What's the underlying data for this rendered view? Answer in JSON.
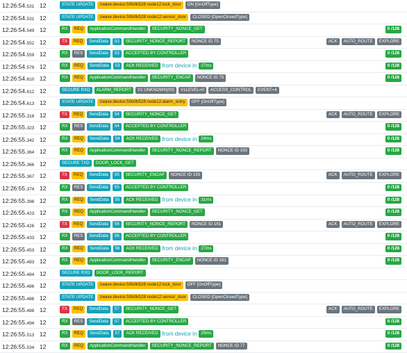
{
  "colors": {
    "green": "#28a745",
    "blue": "#17a2b8",
    "red": "#dc3545",
    "yellow": "#ffc107",
    "gray": "#6c757d",
    "link_text": "#17a2b8"
  },
  "rows": [
    {
      "time": "12:26:54.",
      "ms": "531",
      "node": "12",
      "badges": [
        {
          "t": "STATE UPDATE",
          "c": "blue"
        },
        {
          "t": "zwave:device:50b0b528:node12:lock_door",
          "c": "yellow"
        },
        {
          "t": "ON [OnOffType]",
          "c": "gray"
        }
      ],
      "right": [],
      "right_badge": null
    },
    {
      "time": "12:26:54.",
      "ms": "531",
      "node": "12",
      "badges": [
        {
          "t": "STATE UPDATE",
          "c": "blue"
        },
        {
          "t": "zwave:device:50b0b528:node12:sensor_door",
          "c": "yellow"
        },
        {
          "t": "CLOSED [OpenClosedType]",
          "c": "gray"
        }
      ],
      "right": [],
      "right_badge": null
    },
    {
      "time": "12:26:54.",
      "ms": "549",
      "node": "12",
      "badges": [
        {
          "t": "RX",
          "c": "green"
        },
        {
          "t": "REQ",
          "c": "yellow"
        },
        {
          "t": "ApplicationCommandHandler",
          "c": "green"
        },
        {
          "t": "SECURITY_NONCE_GET",
          "c": "green"
        }
      ],
      "right": [],
      "right_badge": "0 /128"
    },
    {
      "time": "12:26:54.",
      "ms": "552",
      "node": "12",
      "badges": [
        {
          "t": "TX",
          "c": "red"
        },
        {
          "t": "REQ",
          "c": "yellow"
        },
        {
          "t": "SendData",
          "c": "blue"
        },
        {
          "t": "53",
          "c": "blue"
        },
        {
          "t": "SECURITY_NONCE_REPORT",
          "c": "green"
        },
        {
          "t": "NONCE ID 75",
          "c": "gray"
        }
      ],
      "right": [
        "ACK",
        "AUTO_ROUTE",
        "EXPLORE"
      ],
      "right_badge": null
    },
    {
      "time": "12:26:54.",
      "ms": "559",
      "node": "12",
      "badges": [
        {
          "t": "RX",
          "c": "green"
        },
        {
          "t": "RES",
          "c": "gray"
        },
        {
          "t": "SendData",
          "c": "blue"
        },
        {
          "t": "53",
          "c": "blue"
        },
        {
          "t": "ACCEPTED BY CONTROLLER",
          "c": "green"
        }
      ],
      "right": [],
      "right_badge": "0 /128"
    },
    {
      "time": "12:26:54.",
      "ms": "579",
      "node": "12",
      "badges": [
        {
          "t": "RX",
          "c": "green"
        },
        {
          "t": "REQ",
          "c": "yellow"
        },
        {
          "t": "SendData",
          "c": "blue"
        },
        {
          "t": "53",
          "c": "blue"
        },
        {
          "t": "ACK RECEIVED",
          "c": "green"
        },
        {
          "t": "from device in",
          "c": "plain"
        },
        {
          "t": "27ms",
          "c": "green"
        }
      ],
      "right": [],
      "right_badge": "0 /128"
    },
    {
      "time": "12:26:54.",
      "ms": "610",
      "node": "12",
      "badges": [
        {
          "t": "RX",
          "c": "green"
        },
        {
          "t": "REQ",
          "c": "yellow"
        },
        {
          "t": "ApplicationCommandHandler",
          "c": "green"
        },
        {
          "t": "SECURITY_ENCAP",
          "c": "green"
        },
        {
          "t": "NONCE ID 75",
          "c": "gray"
        }
      ],
      "right": [],
      "right_badge": "0 /128"
    },
    {
      "time": "12:26:54.",
      "ms": "612",
      "node": "12",
      "badges": [
        {
          "t": "SECURE RXD",
          "c": "blue"
        },
        {
          "t": "ALARM_REPORT",
          "c": "green"
        },
        {
          "t": "V1 UNKNOWN(00)",
          "c": "gray"
        },
        {
          "t": "V1LEVEL=0",
          "c": "gray"
        },
        {
          "t": "ACCESS_CONTROL",
          "c": "gray"
        },
        {
          "t": "EVENT=4",
          "c": "gray"
        }
      ],
      "right": [],
      "right_badge": null
    },
    {
      "time": "12:26:54.",
      "ms": "613",
      "node": "12",
      "badges": [
        {
          "t": "STATE UPDATE",
          "c": "blue"
        },
        {
          "t": "zwave:device:50b0b528:node12:alarm_entry",
          "c": "yellow"
        },
        {
          "t": "OFF [OnOffType]",
          "c": "gray"
        }
      ],
      "right": [],
      "right_badge": null
    },
    {
      "time": "12:26:55.",
      "ms": "318",
      "node": "12",
      "badges": [
        {
          "t": "TX",
          "c": "red"
        },
        {
          "t": "REQ",
          "c": "yellow"
        },
        {
          "t": "SendData",
          "c": "blue"
        },
        {
          "t": "54",
          "c": "blue"
        },
        {
          "t": "SECURITY_NONCE_GET",
          "c": "green"
        }
      ],
      "right": [
        "ACK",
        "AUTO_ROUTE",
        "EXPLORE"
      ],
      "right_badge": null
    },
    {
      "time": "12:26:55.",
      "ms": "323",
      "node": "12",
      "badges": [
        {
          "t": "RX",
          "c": "green"
        },
        {
          "t": "RES",
          "c": "gray"
        },
        {
          "t": "SendData",
          "c": "blue"
        },
        {
          "t": "54",
          "c": "blue"
        },
        {
          "t": "ACCEPTED BY CONTROLLER",
          "c": "green"
        }
      ],
      "right": [],
      "right_badge": "0 /128"
    },
    {
      "time": "12:26:55.",
      "ms": "342",
      "node": "12",
      "badges": [
        {
          "t": "RX",
          "c": "green"
        },
        {
          "t": "REQ",
          "c": "yellow"
        },
        {
          "t": "SendData",
          "c": "blue"
        },
        {
          "t": "54",
          "c": "blue"
        },
        {
          "t": "ACK RECEIVED",
          "c": "green"
        },
        {
          "t": "from device in",
          "c": "plain"
        },
        {
          "t": "24ms",
          "c": "green"
        }
      ],
      "right": [],
      "right_badge": "0 /128"
    },
    {
      "time": "12:26:55.",
      "ms": "364",
      "node": "12",
      "badges": [
        {
          "t": "RX",
          "c": "green"
        },
        {
          "t": "REQ",
          "c": "yellow"
        },
        {
          "t": "ApplicationCommandHandler",
          "c": "green"
        },
        {
          "t": "SECURITY_NONCE_REPORT",
          "c": "green"
        },
        {
          "t": "NONCE ID 193",
          "c": "gray"
        }
      ],
      "right": [],
      "right_badge": "0 /128"
    },
    {
      "time": "12:26:55.",
      "ms": "366",
      "node": "12",
      "badges": [
        {
          "t": "SECURE TXD",
          "c": "blue"
        },
        {
          "t": "DOOR_LOCK_GET",
          "c": "green"
        }
      ],
      "right": [],
      "right_badge": null
    },
    {
      "time": "12:26:55.",
      "ms": "367",
      "node": "12",
      "badges": [
        {
          "t": "TX",
          "c": "red"
        },
        {
          "t": "REQ",
          "c": "yellow"
        },
        {
          "t": "SendData",
          "c": "blue"
        },
        {
          "t": "55",
          "c": "blue"
        },
        {
          "t": "SECURITY_ENCAP",
          "c": "green"
        },
        {
          "t": "NONCE ID 193",
          "c": "gray"
        }
      ],
      "right": [
        "ACK",
        "AUTO_ROUTE",
        "EXPLORE"
      ],
      "right_badge": null
    },
    {
      "time": "12:26:55.",
      "ms": "374",
      "node": "12",
      "badges": [
        {
          "t": "RX",
          "c": "green"
        },
        {
          "t": "RES",
          "c": "gray"
        },
        {
          "t": "SendData",
          "c": "blue"
        },
        {
          "t": "55",
          "c": "blue"
        },
        {
          "t": "ACCEPTED BY CONTROLLER",
          "c": "green"
        }
      ],
      "right": [],
      "right_badge": "0 /128"
    },
    {
      "time": "12:26:55.",
      "ms": "398",
      "node": "12",
      "badges": [
        {
          "t": "RX",
          "c": "green"
        },
        {
          "t": "REQ",
          "c": "yellow"
        },
        {
          "t": "SendData",
          "c": "blue"
        },
        {
          "t": "55",
          "c": "blue"
        },
        {
          "t": "ACK RECEIVED",
          "c": "green"
        },
        {
          "t": "from device in",
          "c": "plain"
        },
        {
          "t": "31ms",
          "c": "green"
        }
      ],
      "right": [],
      "right_badge": "0 /128"
    },
    {
      "time": "12:26:55.",
      "ms": "423",
      "node": "12",
      "badges": [
        {
          "t": "RX",
          "c": "green"
        },
        {
          "t": "REQ",
          "c": "yellow"
        },
        {
          "t": "ApplicationCommandHandler",
          "c": "green"
        },
        {
          "t": "SECURITY_NONCE_GET",
          "c": "green"
        }
      ],
      "right": [],
      "right_badge": "0 /128"
    },
    {
      "time": "12:26:55.",
      "ms": "426",
      "node": "12",
      "badges": [
        {
          "t": "TX",
          "c": "red"
        },
        {
          "t": "REQ",
          "c": "yellow"
        },
        {
          "t": "SendData",
          "c": "blue"
        },
        {
          "t": "56",
          "c": "blue"
        },
        {
          "t": "SECURITY_NONCE_REPORT",
          "c": "green"
        },
        {
          "t": "NONCE ID 161",
          "c": "gray"
        }
      ],
      "right": [
        "ACK",
        "AUTO_ROUTE",
        "EXPLORE"
      ],
      "right_badge": null
    },
    {
      "time": "12:26:55.",
      "ms": "433",
      "node": "12",
      "badges": [
        {
          "t": "RX",
          "c": "green"
        },
        {
          "t": "RES",
          "c": "gray"
        },
        {
          "t": "SendData",
          "c": "blue"
        },
        {
          "t": "56",
          "c": "blue"
        },
        {
          "t": "ACCEPTED BY CONTROLLER",
          "c": "green"
        }
      ],
      "right": [],
      "right_badge": "0 /128"
    },
    {
      "time": "12:26:55.",
      "ms": "453",
      "node": "12",
      "badges": [
        {
          "t": "RX",
          "c": "green"
        },
        {
          "t": "REQ",
          "c": "yellow"
        },
        {
          "t": "SendData",
          "c": "blue"
        },
        {
          "t": "56",
          "c": "blue"
        },
        {
          "t": "ACK RECEIVED",
          "c": "green"
        },
        {
          "t": "from device in",
          "c": "plain"
        },
        {
          "t": "27ms",
          "c": "green"
        }
      ],
      "right": [],
      "right_badge": "0 /128"
    },
    {
      "time": "12:26:55.",
      "ms": "483",
      "node": "12",
      "badges": [
        {
          "t": "RX",
          "c": "green"
        },
        {
          "t": "REQ",
          "c": "yellow"
        },
        {
          "t": "ApplicationCommandHandler",
          "c": "green"
        },
        {
          "t": "SECURITY_ENCAP",
          "c": "green"
        },
        {
          "t": "NONCE ID 161",
          "c": "gray"
        }
      ],
      "right": [],
      "right_badge": "0 /128"
    },
    {
      "time": "12:26:55.",
      "ms": "484",
      "node": "12",
      "badges": [
        {
          "t": "SECURE RXD",
          "c": "blue"
        },
        {
          "t": "DOOR_LOCK_REPORT",
          "c": "green"
        }
      ],
      "right": [],
      "right_badge": null
    },
    {
      "time": "12:26:55.",
      "ms": "486",
      "node": "12",
      "badges": [
        {
          "t": "STATE UPDATE",
          "c": "blue"
        },
        {
          "t": "zwave:device:50b0b528:node12:lock_door",
          "c": "yellow"
        },
        {
          "t": "OFF [OnOffType]",
          "c": "gray"
        }
      ],
      "right": [],
      "right_badge": null
    },
    {
      "time": "12:26:55.",
      "ms": "486",
      "node": "12",
      "badges": [
        {
          "t": "STATE UPDATE",
          "c": "blue"
        },
        {
          "t": "zwave:device:50b0b528:node12:sensor_door",
          "c": "yellow"
        },
        {
          "t": "CLOSED [OpenClosedType]",
          "c": "gray"
        }
      ],
      "right": [],
      "right_badge": null
    },
    {
      "time": "12:26:55.",
      "ms": "488",
      "node": "12",
      "badges": [
        {
          "t": "TX",
          "c": "red"
        },
        {
          "t": "REQ",
          "c": "yellow"
        },
        {
          "t": "SendData",
          "c": "blue"
        },
        {
          "t": "57",
          "c": "blue"
        },
        {
          "t": "SECURITY_NONCE_GET",
          "c": "green"
        }
      ],
      "right": [
        "ACK",
        "AUTO_ROUTE",
        "EXPLORE"
      ],
      "right_badge": null
    },
    {
      "time": "12:26:55.",
      "ms": "494",
      "node": "12",
      "badges": [
        {
          "t": "RX",
          "c": "green"
        },
        {
          "t": "RES",
          "c": "gray"
        },
        {
          "t": "SendData",
          "c": "blue"
        },
        {
          "t": "57",
          "c": "blue"
        },
        {
          "t": "ACCEPTED BY CONTROLLER",
          "c": "green"
        }
      ],
      "right": [],
      "right_badge": "0 /128"
    },
    {
      "time": "12:26:55.",
      "ms": "513",
      "node": "12",
      "badges": [
        {
          "t": "RX",
          "c": "green"
        },
        {
          "t": "REQ",
          "c": "yellow"
        },
        {
          "t": "SendData",
          "c": "blue"
        },
        {
          "t": "57",
          "c": "blue"
        },
        {
          "t": "ACK RECEIVED",
          "c": "green"
        },
        {
          "t": "from device in",
          "c": "plain"
        },
        {
          "t": "25ms",
          "c": "green"
        }
      ],
      "right": [],
      "right_badge": "0 /128"
    },
    {
      "time": "12:26:55.",
      "ms": "534",
      "node": "12",
      "badges": [
        {
          "t": "RX",
          "c": "green"
        },
        {
          "t": "REQ",
          "c": "yellow"
        },
        {
          "t": "ApplicationCommandHandler",
          "c": "green"
        },
        {
          "t": "SECURITY_NONCE_REPORT",
          "c": "green"
        },
        {
          "t": "NONCE ID 77",
          "c": "gray"
        }
      ],
      "right": [],
      "right_badge": "0 /128"
    }
  ]
}
